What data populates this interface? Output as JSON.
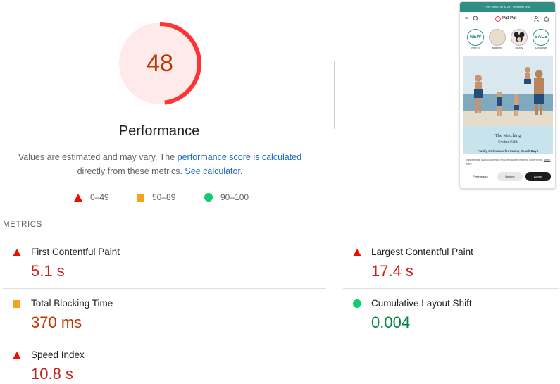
{
  "gauge": {
    "score": "48",
    "score_fraction": 0.48,
    "label": "Performance",
    "ring_color": "#ff3333",
    "fill_color": "#ffeaea",
    "score_color": "#c33300"
  },
  "note": {
    "text_before": "Values are estimated and may vary. The ",
    "link_score": "performance score is calculated",
    "text_middle": " directly from these metrics. ",
    "link_calc": "See calculator."
  },
  "legend": {
    "items": [
      {
        "label": "0–49",
        "shape": "triangle",
        "color": "#eb0f00"
      },
      {
        "label": "50–89",
        "shape": "square",
        "color": "#f4a31f"
      },
      {
        "label": "90–100",
        "shape": "circle",
        "color": "#0cce6b"
      }
    ]
  },
  "preview": {
    "banner": "Free ocean on $129+ | Website only",
    "logo": "Pat Pat",
    "categories": [
      {
        "badge": "NEW",
        "label": "New In"
      },
      {
        "badge": "",
        "label": "Matching"
      },
      {
        "badge": "",
        "label": "Disney"
      },
      {
        "badge": "SALE",
        "label": "Clearance"
      }
    ],
    "hero_title_line1": "The Matching",
    "hero_title_line2": "Swim Edit",
    "hero_subtitle": "Family Swimwear for Sunny Beach Days",
    "cookie_text": "This website uses cookies to ensure you get the best experience.",
    "cookie_link": "Learn more",
    "btn_preferences": "Preferences",
    "btn_decline": "Decline",
    "btn_accept": "Accept"
  },
  "metrics": {
    "title": "METRICS",
    "items": [
      {
        "label": "First Contentful Paint",
        "value": "5.1 s",
        "rating": "fail"
      },
      {
        "label": "Largest Contentful Paint",
        "value": "17.4 s",
        "rating": "fail"
      },
      {
        "label": "Total Blocking Time",
        "value": "370 ms",
        "rating": "average"
      },
      {
        "label": "Cumulative Layout Shift",
        "value": "0.004",
        "rating": "pass"
      },
      {
        "label": "Speed Index",
        "value": "10.8 s",
        "rating": "fail"
      }
    ]
  }
}
